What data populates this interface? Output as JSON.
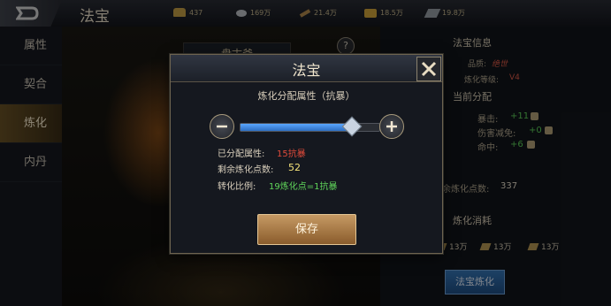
{
  "header": {
    "title": "法宝",
    "resources": [
      {
        "icon": "gold-ingot-icon",
        "value": "437"
      },
      {
        "icon": "silver-coin-icon",
        "value": "169万"
      },
      {
        "icon": "scroll-icon",
        "value": "21.4万"
      },
      {
        "icon": "treasure-icon",
        "value": "18.5万"
      },
      {
        "icon": "iron-ore-icon",
        "value": "19.8万"
      }
    ]
  },
  "sidebar": {
    "items": [
      {
        "label": "属性"
      },
      {
        "label": "契合"
      },
      {
        "label": "炼化",
        "active": true
      },
      {
        "label": "内丹"
      }
    ]
  },
  "scene": {
    "treasure_name": "盘古斧",
    "help_label": "?"
  },
  "right_panel": {
    "info_title": "法宝信息",
    "quality_label": "品质:",
    "quality_value": "绝世",
    "level_label": "炼化等级:",
    "level_value": "V4",
    "alloc_title": "当前分配",
    "stats": [
      {
        "label": "暴击:",
        "value": "+11"
      },
      {
        "label": "伤害减免:",
        "value": "+0"
      },
      {
        "label": "命中:",
        "value": "+6"
      }
    ],
    "remaining_label": "余炼化点数:",
    "remaining_value": "337",
    "cost_title": "炼化消耗",
    "costs": [
      "13万",
      "13万",
      "13万"
    ],
    "refine_button": "法宝炼化"
  },
  "dialog": {
    "title": "法宝",
    "subtitle": "炼化分配属性（抗暴）",
    "slider_fraction": 0.8,
    "allocated_label": "已分配属性:",
    "allocated_value": "15抗暴",
    "remaining_label": "剩余炼化点数:",
    "remaining_value": "52",
    "ratio_label": "转化比例:",
    "ratio_value": "19炼化点=1抗暴",
    "save_button": "保存"
  },
  "colors": {
    "accent_gold": "#c69a64",
    "slider_blue": "#3d8be6",
    "value_red": "#e04a3a",
    "value_green": "#5fd45a",
    "value_yellow": "#f4e27a"
  }
}
